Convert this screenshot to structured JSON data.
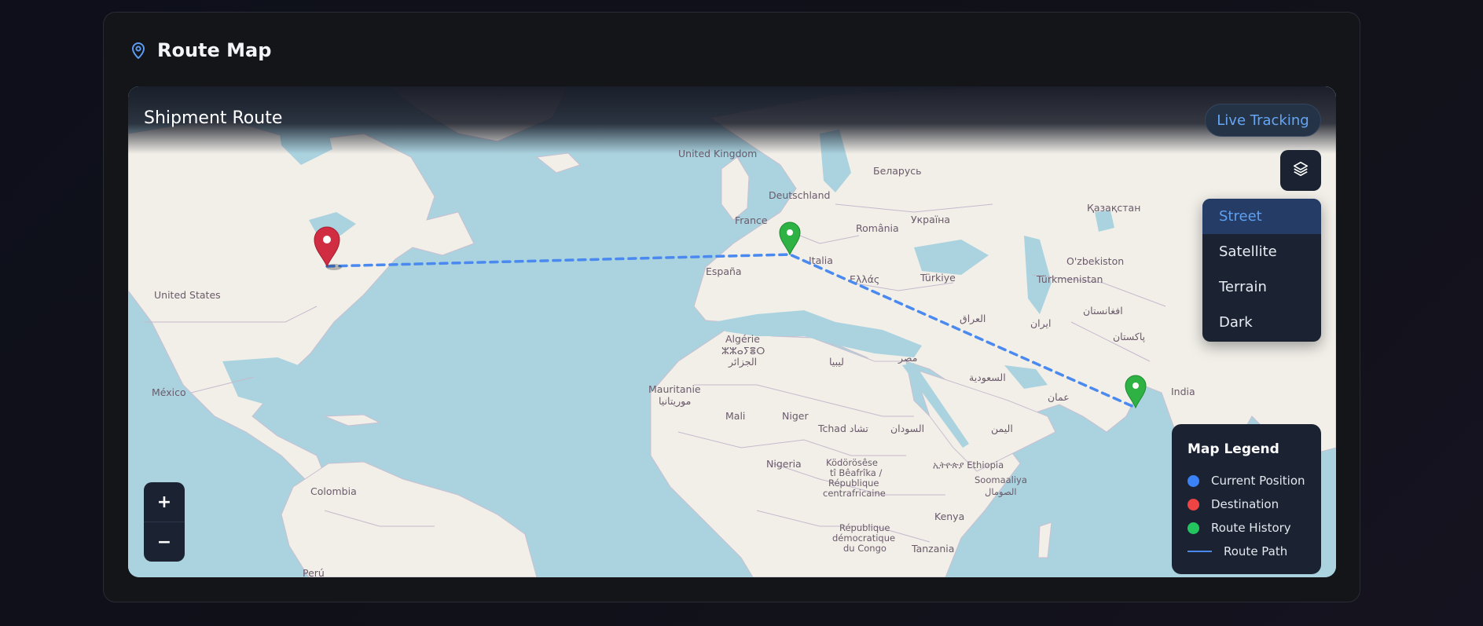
{
  "card": {
    "title": "Route Map",
    "icon": "map-pin-icon"
  },
  "map": {
    "title": "Shipment Route",
    "live_badge": "Live Tracking",
    "layers_icon": "layers-icon",
    "layers": [
      "Street",
      "Satellite",
      "Terrain",
      "Dark"
    ],
    "active_layer": "Street",
    "legend": {
      "title": "Map Legend",
      "items": [
        {
          "label": "Current Position",
          "color": "#3b82f6"
        },
        {
          "label": "Destination",
          "color": "#ef4444"
        },
        {
          "label": "Route History",
          "color": "#22c55e"
        }
      ],
      "path_label": "Route Path",
      "path_color": "#4a8af0"
    },
    "zoom": {
      "in": "+",
      "out": "−"
    },
    "places": {
      "united_kingdom": "United Kingdom",
      "deutschland": "Deutschland",
      "belarus": "Беларусь",
      "ukraina": "Україна",
      "kazakhstan": "Қазақстан",
      "france": "France",
      "romania": "România",
      "espana": "España",
      "italia": "Italia",
      "ellas": "Ελλάς",
      "turkiye": "Türkiye",
      "uzbekistan": "O'zbekiston",
      "turkmenistan": "Türkmenistan",
      "afghanistan": "افغانستان",
      "iraq": "العراق",
      "iran": "ایران",
      "pakistan": "پاکستان",
      "united_states": "United States",
      "mexico": "México",
      "algeria_1": "Algérie",
      "algeria_2": "ⵣⵣⴰⵢⴻⵔ",
      "algeria_3": "الجزائر",
      "libya": "ليبيا",
      "egypt": "مصر",
      "saudi": "السعودية",
      "oman": "عمان",
      "india": "India",
      "mauritania_1": "Mauritanie",
      "mauritania_2": "موريتانيا",
      "mali": "Mali",
      "niger": "Niger",
      "tchad": "Tchad تشاد",
      "sudan": "السودان",
      "yemen": "اليمن",
      "nigeria": "Nigeria",
      "car_1": "Ködörösêse",
      "car_2": "tî Bêafrîka /",
      "car_3": "République",
      "car_4": "centrafricaine",
      "ethiopia": "ኢትዮጵያ Ethiopia",
      "somalia_1": "Soomaaliya",
      "somalia_2": "الصومال",
      "colombia": "Colombia",
      "drc_1": "République",
      "drc_2": "démocratique",
      "drc_3": "du Congo",
      "kenya": "Kenya",
      "tanzania": "Tanzania",
      "peru": "Perú"
    }
  }
}
